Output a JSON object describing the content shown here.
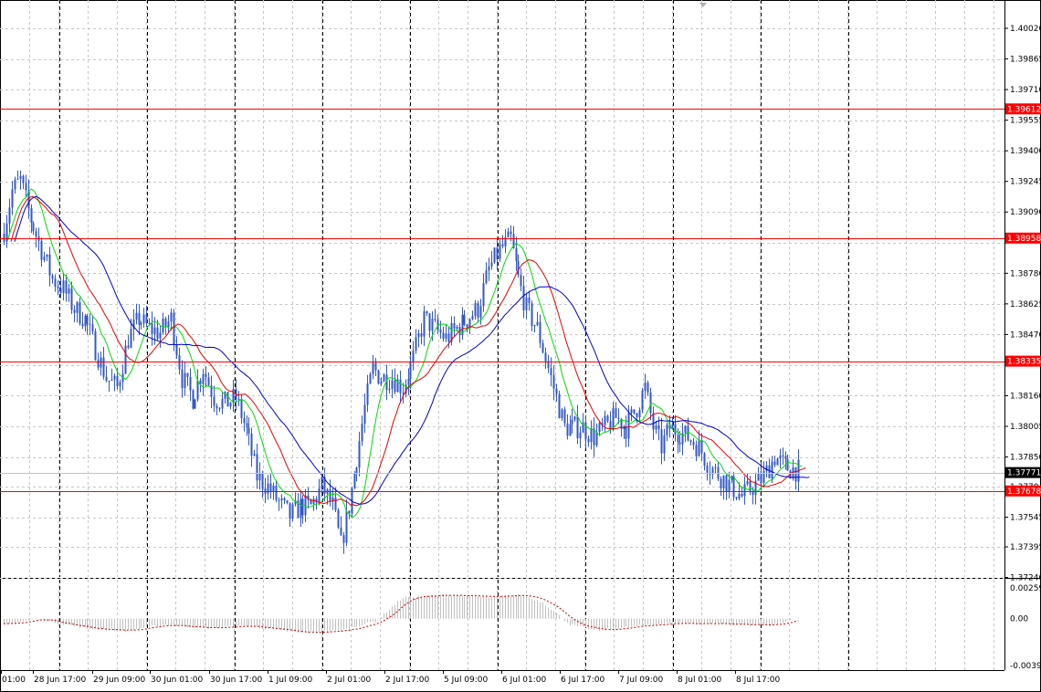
{
  "chart_data": [
    {
      "type": "candlestick",
      "ylim": [
        1.3724,
        1.4012
      ],
      "price_labels": [
        "1.40020",
        "1.39865",
        "1.39710",
        "1.39555",
        "1.39400",
        "1.39245",
        "1.39090",
        "1.38780",
        "1.38625",
        "1.38470",
        "1.38160",
        "1.38005",
        "1.37850",
        "1.37545",
        "1.37395",
        "1.37240"
      ],
      "time_labels": [
        "01:00",
        "28 Jun 17:00",
        "29 Jun 09:00",
        "30 Jun 01:00",
        "30 Jun 17:00",
        "1 Jul 09:00",
        "2 Jul 01:00",
        "2 Jul 17:00",
        "5 Jul 09:00",
        "6 Jul 01:00",
        "6 Jul 17:00",
        "7 Jul 09:00",
        "8 Jul 01:00",
        "8 Jul 17:00"
      ],
      "levels": [
        {
          "value": 1.39612,
          "label": "1.39612",
          "color": "#ff0000"
        },
        {
          "value": 1.38958,
          "label": "1.38958",
          "color": "#ff0000"
        },
        {
          "value": 1.38335,
          "label": "1.38335",
          "color": "#ff0000"
        },
        {
          "value": 1.37678,
          "label": "1.37678",
          "color": "#ff0000"
        }
      ],
      "current_price": {
        "value": 1.37771,
        "label": "1.37771"
      },
      "partially_hidden_label": "1.3770",
      "close_anchors": [
        [
          0,
          1.39
        ],
        [
          3,
          1.392
        ],
        [
          6,
          1.3925
        ],
        [
          10,
          1.3905
        ],
        [
          14,
          1.389
        ],
        [
          18,
          1.3875
        ],
        [
          22,
          1.387
        ],
        [
          26,
          1.386
        ],
        [
          30,
          1.3855
        ],
        [
          34,
          1.384
        ],
        [
          38,
          1.3825
        ],
        [
          42,
          1.382
        ],
        [
          46,
          1.3845
        ],
        [
          50,
          1.3855
        ],
        [
          54,
          1.385
        ],
        [
          58,
          1.3848
        ],
        [
          62,
          1.3855
        ],
        [
          66,
          1.3825
        ],
        [
          70,
          1.3815
        ],
        [
          74,
          1.383
        ],
        [
          78,
          1.3815
        ],
        [
          82,
          1.3812
        ],
        [
          86,
          1.3815
        ],
        [
          90,
          1.3798
        ],
        [
          94,
          1.3775
        ],
        [
          98,
          1.377
        ],
        [
          102,
          1.3762
        ],
        [
          106,
          1.3755
        ],
        [
          110,
          1.376
        ],
        [
          114,
          1.376
        ],
        [
          118,
          1.377
        ],
        [
          122,
          1.376
        ],
        [
          125,
          1.374
        ],
        [
          128,
          1.376
        ],
        [
          131,
          1.3785
        ],
        [
          134,
          1.381
        ],
        [
          137,
          1.383
        ],
        [
          140,
          1.3825
        ],
        [
          144,
          1.3825
        ],
        [
          148,
          1.382
        ],
        [
          152,
          1.3835
        ],
        [
          156,
          1.3855
        ],
        [
          160,
          1.385
        ],
        [
          164,
          1.3845
        ],
        [
          168,
          1.385
        ],
        [
          172,
          1.3855
        ],
        [
          176,
          1.386
        ],
        [
          180,
          1.388
        ],
        [
          184,
          1.389
        ],
        [
          188,
          1.3895
        ],
        [
          191,
          1.3875
        ],
        [
          194,
          1.386
        ],
        [
          198,
          1.385
        ],
        [
          202,
          1.383
        ],
        [
          205,
          1.3815
        ],
        [
          208,
          1.38
        ],
        [
          211,
          1.38
        ],
        [
          215,
          1.38
        ],
        [
          219,
          1.3795
        ],
        [
          223,
          1.38
        ],
        [
          227,
          1.3805
        ],
        [
          231,
          1.38
        ],
        [
          235,
          1.381
        ],
        [
          238,
          1.382
        ],
        [
          241,
          1.38
        ],
        [
          244,
          1.379
        ],
        [
          247,
          1.38
        ],
        [
          250,
          1.3798
        ],
        [
          254,
          1.3795
        ],
        [
          258,
          1.379
        ],
        [
          262,
          1.378
        ],
        [
          266,
          1.3775
        ],
        [
          270,
          1.377
        ],
        [
          274,
          1.3765
        ],
        [
          278,
          1.377
        ],
        [
          282,
          1.3775
        ],
        [
          286,
          1.3785
        ],
        [
          290,
          1.378
        ],
        [
          295,
          1.3778
        ]
      ],
      "indicators": [
        {
          "color": "#00dd00"
        },
        {
          "color": "#ee0000"
        },
        {
          "color": "#0000dd"
        }
      ]
    },
    {
      "type": "histogram",
      "ylim": [
        -0.00394,
        0.00259
      ],
      "labels": [
        "0.002599",
        "0.00",
        "-0.00394"
      ],
      "anchors": [
        [
          0,
          -0.0005
        ],
        [
          12,
          0.0
        ],
        [
          30,
          -0.0008
        ],
        [
          45,
          -0.001
        ],
        [
          60,
          -0.0005
        ],
        [
          75,
          -0.0008
        ],
        [
          90,
          -0.0006
        ],
        [
          110,
          -0.0012
        ],
        [
          125,
          -0.001
        ],
        [
          138,
          -0.0002
        ],
        [
          148,
          0.0018
        ],
        [
          165,
          0.002
        ],
        [
          180,
          0.0018
        ],
        [
          192,
          0.002
        ],
        [
          200,
          0.0014
        ],
        [
          210,
          -0.0005
        ],
        [
          220,
          -0.001
        ],
        [
          232,
          -0.0007
        ],
        [
          245,
          -0.0004
        ],
        [
          262,
          -0.0004
        ],
        [
          275,
          -0.0005
        ],
        [
          285,
          -0.0005
        ],
        [
          295,
          0.0
        ]
      ],
      "signal_color": "#cc0000",
      "bar_color": "#c0c0c0"
    }
  ]
}
